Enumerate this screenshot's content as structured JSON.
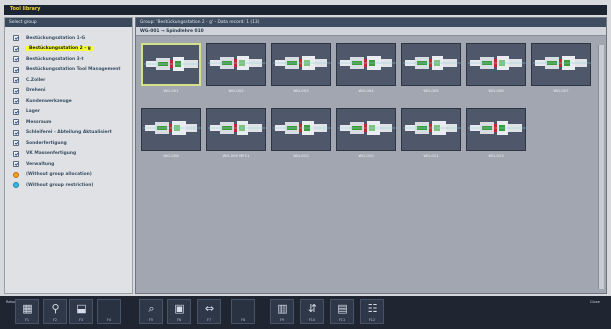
{
  "window": {
    "title": "Tool library"
  },
  "sidebar": {
    "header": "Select group",
    "items": [
      {
        "label": "Bestückungsstation 1-G",
        "icon": "check-icon",
        "selected": false
      },
      {
        "label": "Bestückungsstation 2 - g",
        "icon": "check-icon",
        "selected": true
      },
      {
        "label": "Bestückungsstation 3-t",
        "icon": "check-icon",
        "selected": false
      },
      {
        "label": "Bestückungsstation Tool Management",
        "icon": "check-icon",
        "selected": false
      },
      {
        "label": "C.Zoller",
        "icon": "check-icon",
        "selected": false
      },
      {
        "label": "Dreheni",
        "icon": "check-icon",
        "selected": false
      },
      {
        "label": "Kundenwerkzeuge",
        "icon": "check-icon",
        "selected": false
      },
      {
        "label": "Lager",
        "icon": "check-icon",
        "selected": false
      },
      {
        "label": "Messraum",
        "icon": "check-icon",
        "selected": false
      },
      {
        "label": "Schleiferei - Abteilung Aktualisiert",
        "icon": "check-icon",
        "selected": false
      },
      {
        "label": "Sonderfertigung",
        "icon": "check-icon",
        "selected": false
      },
      {
        "label": "VK Massenfertigung",
        "icon": "check-icon",
        "selected": false
      },
      {
        "label": "Verwaltung",
        "icon": "check-icon",
        "selected": false
      },
      {
        "label": "(Without group allocation)",
        "icon": "warning-icon",
        "selected": false
      },
      {
        "label": "(Without group restriction)",
        "icon": "info-icon",
        "selected": false
      }
    ]
  },
  "main": {
    "header": "Group: 'Bestückungsstation 2 - g' - Data record: 1 (13)",
    "subheader": "WG-001 → Spindlehre 010",
    "holders": [
      {
        "label": "WG-001",
        "selected": true
      },
      {
        "label": "WG-002",
        "selected": false
      },
      {
        "label": "WG-003",
        "selected": false
      },
      {
        "label": "WG-004",
        "selected": false
      },
      {
        "label": "WG-005",
        "selected": false
      },
      {
        "label": "WG-006",
        "selected": false
      },
      {
        "label": "WG-007",
        "selected": false
      },
      {
        "label": "WG-008",
        "selected": false
      },
      {
        "label": "WG-009 MF11",
        "selected": false
      },
      {
        "label": "WG-010",
        "selected": false
      },
      {
        "label": "WG-010",
        "selected": false
      },
      {
        "label": "WG-011",
        "selected": false
      },
      {
        "label": "WG-013",
        "selected": false
      }
    ]
  },
  "toolbar": {
    "buttons": [
      {
        "name": "search-button",
        "icon": "search-icon",
        "label": "F1"
      },
      {
        "name": "tool-holder-button",
        "icon": "holder-icon",
        "label": "F2"
      },
      {
        "name": "tool-insert-button",
        "icon": "insert-icon",
        "label": "F3"
      },
      {
        "name": "empty-button-1",
        "icon": "",
        "label": "F4"
      },
      {
        "name": "find-tool-button",
        "icon": "magnifier-icon",
        "label": "F5"
      },
      {
        "name": "assembly-button",
        "icon": "assembly-icon",
        "label": "F6"
      },
      {
        "name": "measure-button",
        "icon": "measure-icon",
        "label": "F7"
      },
      {
        "name": "empty-button-2",
        "icon": "",
        "label": "F8"
      },
      {
        "name": "compare-button",
        "icon": "compare-icon",
        "label": "F9"
      },
      {
        "name": "transfer-button",
        "icon": "transfer-icon",
        "label": "F10"
      },
      {
        "name": "print-button",
        "icon": "print-icon",
        "label": "F11"
      },
      {
        "name": "tool-list-button",
        "icon": "toollist-icon",
        "label": "F12"
      }
    ],
    "left_caption": "Return",
    "right_caption": "Close"
  }
}
